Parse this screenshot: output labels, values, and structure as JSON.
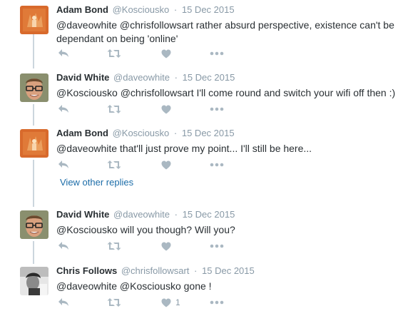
{
  "tweets": [
    {
      "fullname": "Adam Bond",
      "username": "@Kosciousko",
      "separator": "·",
      "date": "15 Dec 2015",
      "text_line1": "@daveowhite @chrisfollowsart rather absurd perspective, existence can't be",
      "text_line2": "dependant on  being 'online'",
      "avatar": "orange-art-avatar"
    },
    {
      "fullname": "David White",
      "username": "@daveowhite",
      "separator": "·",
      "date": "15 Dec 2015",
      "text_line1": "@Kosciousko @chrisfollowsart I'll come round and switch your wifi off then :)",
      "avatar": "glasses-man-avatar"
    },
    {
      "fullname": "Adam Bond",
      "username": "@Kosciousko",
      "separator": "·",
      "date": "15 Dec 2015",
      "text_line1": "@daveowhite that'll just prove my point... I'll still be here...",
      "avatar": "orange-art-avatar"
    },
    {
      "fullname": "David White",
      "username": "@daveowhite",
      "separator": "·",
      "date": "15 Dec 2015",
      "text_line1": "@Kosciousko will you though? Will you?",
      "avatar": "glasses-man-avatar"
    },
    {
      "fullname": "Chris Follows",
      "username": "@chrisfollowsart",
      "separator": "·",
      "date": "15 Dec 2015",
      "text_line1": "@daveowhite @Kosciousko gone !",
      "like_count": "1",
      "avatar": "bw-photo-avatar"
    }
  ],
  "view_other_replies": "View other replies",
  "icons": {
    "reply": "reply-icon",
    "retweet": "retweet-icon",
    "like": "heart-icon",
    "more": "more-dots-icon"
  },
  "colors": {
    "name": "#292f33",
    "meta": "#8899a6",
    "icon": "#aab8c2",
    "link": "#1b6ca8",
    "connector": "#ccd6dd",
    "avatar_orange": "#d86a2c"
  }
}
